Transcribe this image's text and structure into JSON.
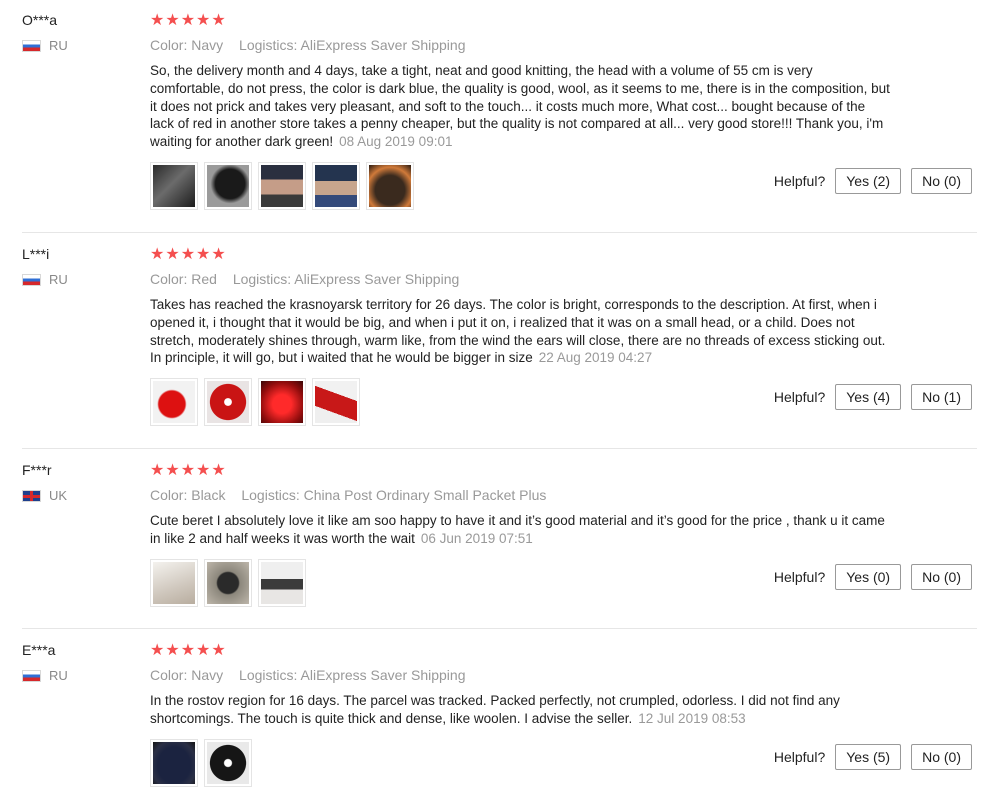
{
  "helpful_label": "Helpful?",
  "star_glyphs": "★★★★★",
  "reviews": [
    {
      "user": "O***a",
      "country": "RU",
      "color": "Color: Navy",
      "logistics": "Logistics: AliExpress Saver Shipping",
      "text": "So, the delivery month and 4 days, take a tight, neat and good knitting, the head with a volume of 55 cm is very comfortable, do not press, the color is dark blue, the quality is good, wool, as it seems to me, there is in the composition, but it does not prick and takes very pleasant, and soft to the touch... it costs much more, What cost... bought because of the lack of red in another store takes a penny cheaper, but the quality is not compared at all... very good store!!! Thank you, i'm waiting for another dark green!",
      "date": "08 Aug 2019 09:01",
      "yes": "Yes (2)",
      "no": "No (0)"
    },
    {
      "user": "L***i",
      "country": "RU",
      "color": "Color: Red",
      "logistics": "Logistics: AliExpress Saver Shipping",
      "text": "Takes has reached the krasnoyarsk territory for 26 days. The color is bright, corresponds to the description. At first, when i opened it, i thought that it would be big, and when i put it on, i realized that it was on a small head, or a child. Does not stretch, moderately shines through, warm like, from the wind the ears will close, there are no threads of excess sticking out. In principle, it will go, but i waited that he would be bigger in size",
      "date": "22 Aug 2019 04:27",
      "yes": "Yes (4)",
      "no": "No (1)"
    },
    {
      "user": "F***r",
      "country": "UK",
      "color": "Color: Black",
      "logistics": "Logistics: China Post Ordinary Small Packet Plus",
      "text": "Cute beret I absolutely love it like am soo happy to have it and it’s good material and it’s good for the price , thank u it came in like 2 and half weeks it was worth the wait",
      "date": "06 Jun 2019 07:51",
      "yes": "Yes (0)",
      "no": "No (0)"
    },
    {
      "user": "E***a",
      "country": "RU",
      "color": "Color: Navy",
      "logistics": "Logistics: AliExpress Saver Shipping",
      "text": "In the rostov region for 16 days. The parcel was tracked. Packed perfectly, not crumpled, odorless. I did not find any shortcomings. The touch is quite thick and dense, like woolen. I advise the seller.",
      "date": "12 Jul 2019 08:53",
      "yes": "Yes (5)",
      "no": "No (0)"
    }
  ]
}
